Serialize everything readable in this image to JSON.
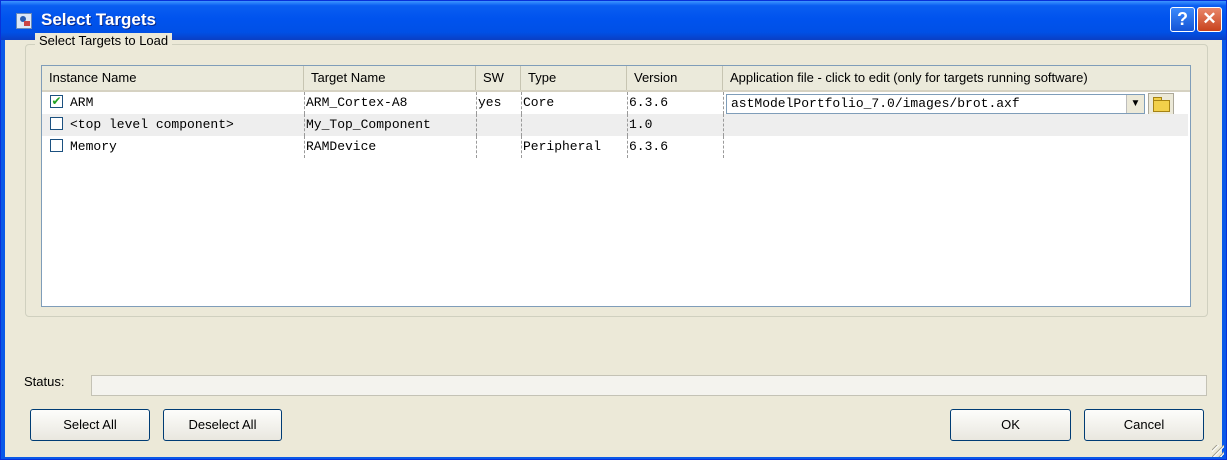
{
  "window": {
    "title": "Select Targets",
    "help_label": "?",
    "close_label": "✕"
  },
  "group": {
    "label": "Select Targets to Load"
  },
  "table": {
    "columns": [
      "Instance Name",
      "Target Name",
      "SW",
      "Type",
      "Version",
      "Application file - click to edit (only for targets running software)"
    ],
    "rows": [
      {
        "checked": true,
        "check_glyph": "✔",
        "instance": "ARM",
        "target": "ARM_Cortex-A8",
        "sw": "yes",
        "type": "Core",
        "version": "6.3.6",
        "app_file": "astModelPortfolio_7.0/images/brot.axf"
      },
      {
        "checked": false,
        "check_glyph": "",
        "instance": "<top level component>",
        "target": "My_Top_Component",
        "sw": "",
        "type": "",
        "version": "1.0",
        "app_file": ""
      },
      {
        "checked": false,
        "check_glyph": "",
        "instance": "Memory",
        "target": "RAMDevice",
        "sw": "",
        "type": "Peripheral",
        "version": "6.3.6",
        "app_file": ""
      }
    ]
  },
  "icons": {
    "dropdown": "▼",
    "open_folder": "open-folder-icon"
  },
  "status": {
    "label": "Status:",
    "value": ""
  },
  "buttons": {
    "select_all": "Select All",
    "deselect_all": "Deselect All",
    "ok": "OK",
    "cancel": "Cancel"
  },
  "colors": {
    "titlebar": "#0053ee",
    "dialog_bg": "#ece9d8",
    "row_alt": "#eeeeee"
  }
}
